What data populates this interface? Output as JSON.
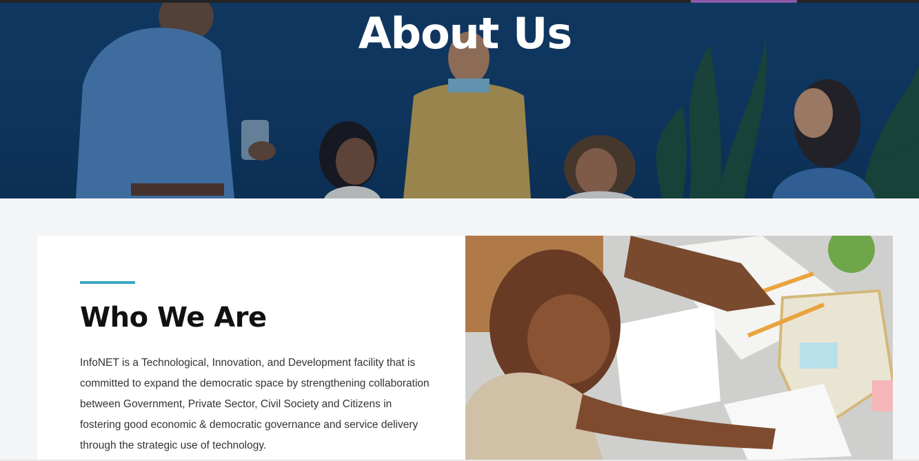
{
  "hero": {
    "title": "About Us"
  },
  "about": {
    "heading": "Who We Are",
    "body": "InfoNET is a Technological, Innovation, and Development facility that is committed to expand the democratic space by strengthening collaboration between Government, Private Sector, Civil Society and Citizens in fostering good economic & democratic governance and service delivery through the strategic use of technology."
  },
  "colors": {
    "accent": "#3aa7c2",
    "nav_active": "#8a5aa6",
    "hero_bg": "#113a63"
  }
}
